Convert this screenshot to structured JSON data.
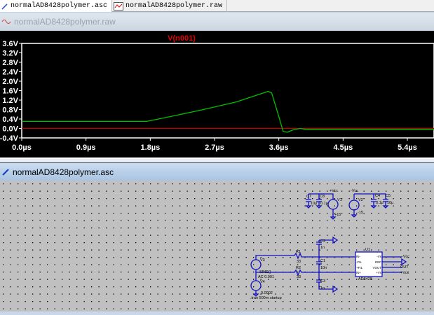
{
  "tabs": [
    {
      "label": "normalAD8428polymer.asc",
      "icon": "schematic-icon",
      "active": true
    },
    {
      "label": "normalAD8428polymer.raw",
      "icon": "waveform-icon",
      "active": false
    }
  ],
  "raw_window": {
    "title": "normalAD8428polymer.raw"
  },
  "asc_window": {
    "title": "normalAD8428polymer.asc"
  },
  "chart_data": {
    "type": "line",
    "title": "V(n001)",
    "xlabel": "",
    "ylabel": "",
    "xlim": [
      0,
      5.8
    ],
    "ylim": [
      -0.4,
      3.6
    ],
    "x_ticks": [
      "0.0µs",
      "0.9µs",
      "1.8µs",
      "2.7µs",
      "3.6µs",
      "4.5µs",
      "5.4µs"
    ],
    "y_ticks": [
      "3.6V",
      "3.2V",
      "2.8V",
      "2.4V",
      "2.0V",
      "1.6V",
      "1.2V",
      "0.8V",
      "0.4V",
      "0.0V",
      "-0.4V"
    ],
    "background": "#000000",
    "series": [
      {
        "name": "V(n001)",
        "color": "#00c000",
        "x": [
          0,
          1.75,
          2.0,
          2.5,
          3.0,
          3.45,
          3.5,
          3.6,
          3.66,
          3.72,
          3.8,
          3.9,
          4.0,
          5.8
        ],
        "y": [
          0.3,
          0.3,
          0.45,
          0.77,
          1.12,
          1.57,
          1.5,
          0.5,
          -0.12,
          -0.16,
          -0.06,
          0.0,
          -0.05,
          -0.05
        ]
      },
      {
        "color": "#c00000",
        "x": [
          0,
          5.8
        ],
        "y": [
          0,
          0
        ]
      }
    ]
  },
  "schematic": {
    "labels": {
      "vcc_pos": "+Vcc",
      "vcc_neg": "-Vcc",
      "v1": "V1",
      "v1_val": "+15",
      "v2": "V2",
      "v2_val": "-15",
      "c7": "C7",
      "c7_val": "10µ",
      "c8": "C8",
      "c8_val": "0.1µ",
      "c4": "C4",
      "c4_val": "0.1µ",
      "c5": "C5",
      "c5_val": "10µ",
      "c2": "C2",
      "c2_val": "1n",
      "c1": "C1",
      "c1_val": "10n",
      "c3": "C3",
      "c3_val": "1n",
      "r1": "R1",
      "r1_val": "33",
      "r2": "R2",
      "r2_val": "33",
      "v3": "V3",
      "v3_val1": "SINE()",
      "v3_val2": "AC 0.001",
      "v4": "V4",
      "v4_val": "0.0002",
      "tran": ".tran 500m startup",
      "u1": "U1",
      "u1_part": "AD8428",
      "pin_in_neg": "IN-",
      "pin_fil_neg": "-FIL",
      "pin_fil_pos": "+FIL",
      "pin_in_pos": "IN+",
      "pin_vs_neg": "-Vs",
      "pin_ref": "REF",
      "pin_vout": "VOUT",
      "pin_vs_pos": "+Vs",
      "net_vcc_neg": "-Vcc",
      "net_out": "OUT",
      "net_vcc_pos": "+Vcc"
    },
    "wire_color": "#0000c0",
    "text_color": "#000000"
  }
}
